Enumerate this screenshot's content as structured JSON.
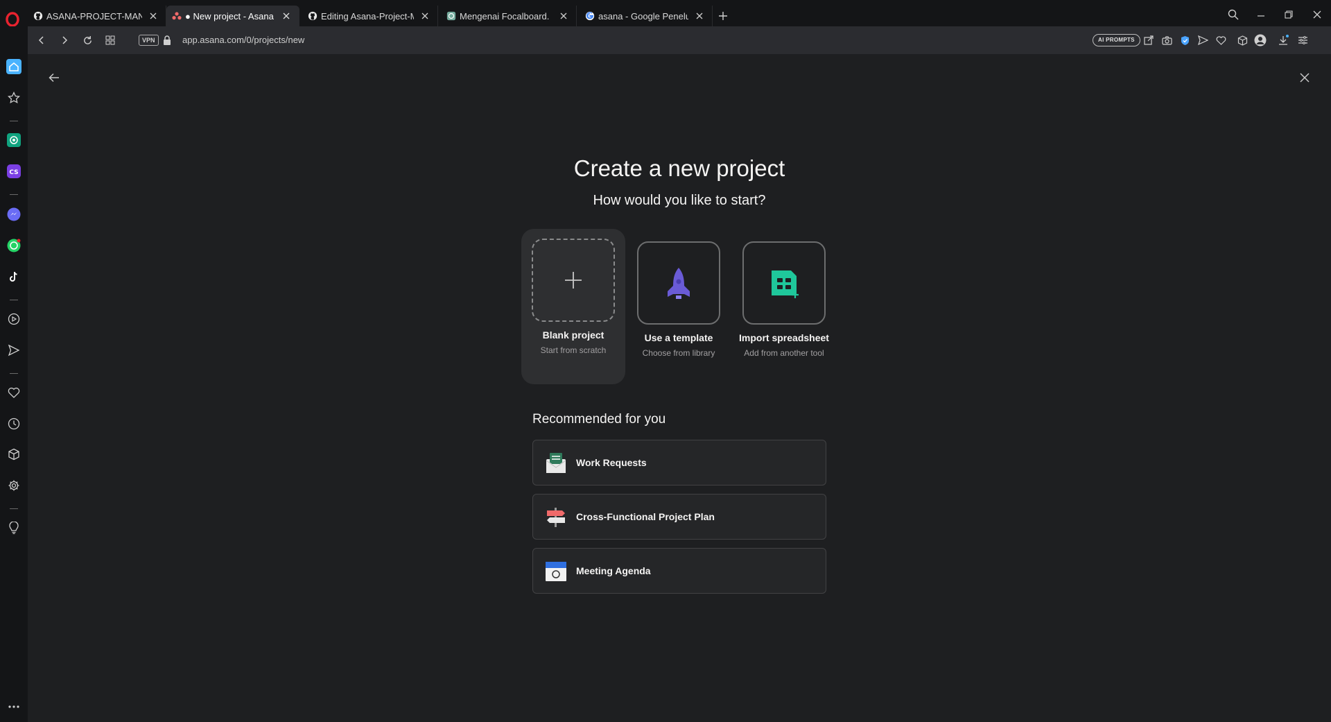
{
  "browser": {
    "tabs": [
      {
        "label": "ASANA-PROJECT-MANAGE",
        "icon": "github-icon",
        "active": false
      },
      {
        "label": "● New project - Asana",
        "icon": "asana-icon",
        "active": true
      },
      {
        "label": "Editing Asana-Project-Man",
        "icon": "github-icon",
        "active": false
      },
      {
        "label": "Mengenai Focalboard.",
        "icon": "chatgpt-icon",
        "active": false
      },
      {
        "label": "asana - Google Penelusura",
        "icon": "google-icon",
        "active": false
      }
    ],
    "vpn_label": "VPN",
    "url": "app.asana.com/0/projects/new",
    "ai_prompts_label": "AI PROMPTS"
  },
  "header": {
    "title": "Create a new project",
    "subtitle": "How would you like to start?"
  },
  "options": [
    {
      "label": "Blank project",
      "desc": "Start from scratch",
      "icon": "plus-icon",
      "selected": true
    },
    {
      "label": "Use a template",
      "desc": "Choose from library",
      "icon": "rocket-icon",
      "selected": false
    },
    {
      "label": "Import spreadsheet",
      "desc": "Add from another tool",
      "icon": "spreadsheet-icon",
      "selected": false
    }
  ],
  "recommended": {
    "title": "Recommended for you",
    "items": [
      {
        "label": "Work Requests",
        "icon": "envelope-icon"
      },
      {
        "label": "Cross-Functional Project Plan",
        "icon": "signpost-icon"
      },
      {
        "label": "Meeting Agenda",
        "icon": "calendar-icon"
      }
    ]
  },
  "colors": {
    "background": "#1e1f21",
    "selected_option": "#2e2f31",
    "template_purple": "#6a5bd6",
    "spreadsheet_green": "#1fc79b"
  }
}
